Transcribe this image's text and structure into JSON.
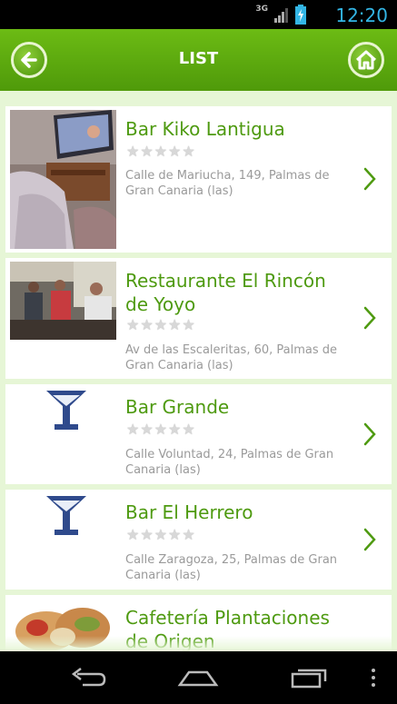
{
  "status_bar": {
    "network": "3G",
    "time": "12:20",
    "icons": [
      "signal-icon",
      "battery-charging-icon"
    ]
  },
  "header": {
    "title": "LIST",
    "back_icon": "back-arrow-icon",
    "home_icon": "home-icon"
  },
  "items": [
    {
      "name": "Bar Kiko Lantigua",
      "address": "Calle de Mariucha, 149, Palmas de Gran Canaria (las)",
      "rating_stars": 0,
      "thumbnail": "photo"
    },
    {
      "name": "Restaurante El Rincón de Yoyo",
      "address": "Av de las Escaleritas, 60, Palmas de Gran Canaria (las)",
      "rating_stars": 0,
      "thumbnail": "photo"
    },
    {
      "name": "Bar Grande",
      "address": "Calle Voluntad, 24, Palmas de Gran Canaria (las)",
      "rating_stars": 0,
      "thumbnail": "cocktail-glass-icon"
    },
    {
      "name": "Bar El Herrero",
      "address": "Calle Zaragoza, 25, Palmas de Gran Canaria (las)",
      "rating_stars": 0,
      "thumbnail": "cocktail-glass-icon"
    },
    {
      "name": "Cafetería Plantaciones de Origen",
      "address": "",
      "rating_stars": 0,
      "thumbnail": "photo"
    }
  ],
  "colors": {
    "accent_green": "#4e9a10",
    "header_green": "#5ea80e",
    "list_bg": "#e6f6d6",
    "clock_blue": "#33b5e5",
    "glass_blue": "#2f4a8c"
  },
  "nav_bar": {
    "icons": [
      "back-nav-icon",
      "home-nav-icon",
      "recents-nav-icon",
      "menu-nav-icon"
    ]
  }
}
